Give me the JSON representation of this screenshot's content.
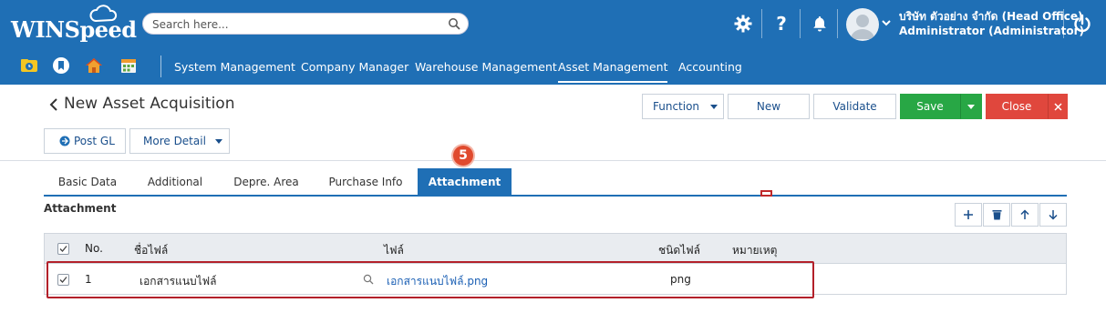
{
  "app": {
    "logo_text": "WINSpeed"
  },
  "search": {
    "placeholder": "Search here..."
  },
  "header": {
    "company_line1": "บริษัท ตัวอย่าง จำกัด (Head Office)",
    "company_line2": "Administrator (Administrator)"
  },
  "nav": {
    "items": [
      {
        "label": "System Management"
      },
      {
        "label": "Company Manager"
      },
      {
        "label": "Warehouse Management"
      },
      {
        "label": "Asset Management"
      },
      {
        "label": "Accounting"
      }
    ],
    "active": "Asset Management"
  },
  "page": {
    "title": "New Asset Acquisition",
    "post_gl_label": "Post GL",
    "more_detail_label": "More Detail"
  },
  "toolbar": {
    "function_label": "Function",
    "new_label": "New",
    "validate_label": "Validate",
    "save_label": "Save",
    "close_label": "Close"
  },
  "step_marker": "5",
  "tabs": [
    {
      "label": "Basic Data"
    },
    {
      "label": "Additional"
    },
    {
      "label": "Depre. Area"
    },
    {
      "label": "Purchase Info"
    },
    {
      "label": "Attachment"
    }
  ],
  "active_tab": "Attachment",
  "section": {
    "title": "Attachment"
  },
  "grid": {
    "columns": [
      "No.",
      "ชื่อไฟล์",
      "ไฟล์",
      "ชนิดไฟล์",
      "หมายเหตุ"
    ],
    "rows": [
      {
        "no": "1",
        "name": "เอกสารแนบไฟล์",
        "file": "เอกสารแนบไฟล์.png",
        "type": "png",
        "note": "",
        "checked": true
      }
    ]
  },
  "colors": {
    "header_bg": "#1f6fb5",
    "save": "#28a745",
    "close": "#e0473d",
    "highlight": "#b3202a"
  },
  "icons": [
    "cloud-icon",
    "search-icon",
    "gear-icon",
    "help-icon",
    "bell-icon",
    "user-avatar-icon",
    "power-icon",
    "clock-folder-icon",
    "bookmark-icon",
    "home-icon",
    "calendar-icon",
    "chevron-left-icon",
    "post-gl-icon",
    "add-icon",
    "delete-icon",
    "arrow-up-icon",
    "arrow-down-icon",
    "magnifier-icon",
    "checkbox-icon"
  ]
}
